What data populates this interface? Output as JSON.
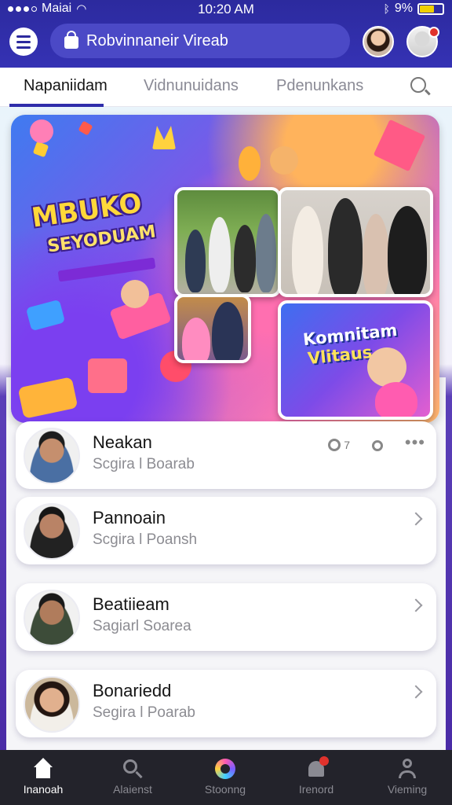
{
  "status": {
    "time": "10:20 AM",
    "carrier": "Maiai",
    "battery": "9%"
  },
  "header": {
    "search_text": "Robvinnaneir Vireab",
    "notif_badge": ""
  },
  "tabs": [
    {
      "label": "Napaniidam"
    },
    {
      "label": "Vidnunuidans"
    },
    {
      "label": "Pdenunkans"
    }
  ],
  "hero": {
    "title": "MBUKO",
    "subtitle": "SEYODUAM",
    "card_title": "Komnitam",
    "card_subtitle": "Vlitaus"
  },
  "list": [
    {
      "name": "Neakan",
      "sub": "Scgira l Boarab",
      "meta": "7"
    },
    {
      "name": "Pannoain",
      "sub": "Scgira l Poansh"
    },
    {
      "name": "Beatiieam",
      "sub": "Sagiarl Soarea"
    },
    {
      "name": "Bonariedd",
      "sub": "Segira l Poarab"
    }
  ],
  "nav": [
    {
      "label": "Inanoah"
    },
    {
      "label": "Alaienst"
    },
    {
      "label": "Stoonng"
    },
    {
      "label": "Irenord"
    },
    {
      "label": "Vieming"
    }
  ],
  "colors": {
    "accent": "#2f2daa",
    "nav_bg": "#23232b"
  }
}
